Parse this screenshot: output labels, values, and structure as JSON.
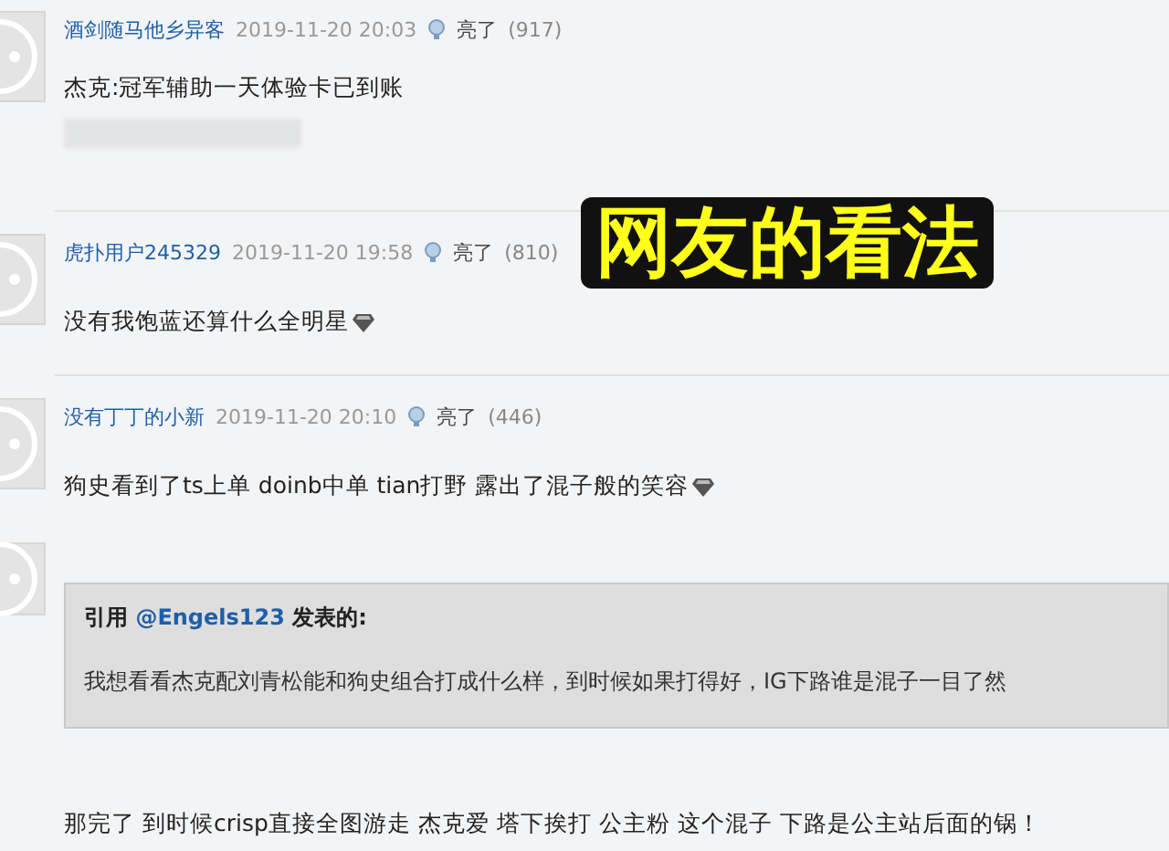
{
  "caption": "网友的看法",
  "posts": [
    {
      "kind": "post",
      "author": "酒剑随马他乡异客",
      "time": "2019-11-20 20:03",
      "like_label": "亮了",
      "like_count": "(917)",
      "body": "杰克:冠军辅助一天体验卡已到账",
      "emoji": false,
      "redacted": true
    },
    {
      "kind": "post",
      "author": "虎扑用户245329",
      "time": "2019-11-20 19:58",
      "like_label": "亮了",
      "like_count": "(810)",
      "body": "没有我饱蓝还算什么全明星",
      "emoji": true,
      "redacted": false
    },
    {
      "kind": "post",
      "author": "没有丁丁的小新",
      "time": "2019-11-20 20:10",
      "like_label": "亮了",
      "like_count": "(446)",
      "body": "狗史看到了ts上单 doinb中单 tian打野 露出了混子般的笑容",
      "emoji": true,
      "redacted": false
    },
    {
      "kind": "reply",
      "quote": {
        "prefix": "引用",
        "user": "@Engels123",
        "suffix": "发表的:",
        "text": "我想看看杰克配刘青松能和狗史组合打成什么样，到时候如果打得好，IG下路谁是混子一目了然"
      },
      "body": "那完了 到时候crisp直接全图游走 杰克爱 塔下挨打 公主粉 这个混子 下路是公主站后面的锅！",
      "emoji": false,
      "redacted": false
    }
  ]
}
